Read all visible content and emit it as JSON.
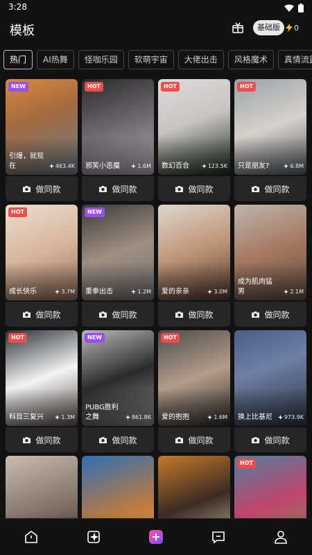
{
  "status": {
    "time": "3:28"
  },
  "header": {
    "title": "模板",
    "plan_label": "基础版",
    "credits": "0"
  },
  "tabs": [
    "热门",
    "AI热舞",
    "怪咖乐园",
    "软萌宇宙",
    "大佬出击",
    "风格魔术",
    "真情流露"
  ],
  "action_label": "做同款",
  "cards": [
    {
      "badge": "NEW",
      "title": "引爆，就现在",
      "uses": "463.4K",
      "bg": "linear-gradient(160deg,#d98a3d,#a56a3f 40%,#6d7c86)"
    },
    {
      "badge": "HOT",
      "title": "邪笑小恶魔",
      "uses": "1.6M",
      "bg": "linear-gradient(160deg,#2a2a2a,#6f6a70 50%,#b4aab7)"
    },
    {
      "badge": "HOT",
      "title": "数幻百合",
      "uses": "123.5K",
      "bg": "linear-gradient(160deg,#dcdcdc,#c8c4c2 45%,#1d2b1d)"
    },
    {
      "badge": "HOT",
      "title": "只是朋友?",
      "uses": "6.8M",
      "bg": "linear-gradient(160deg,#9aa3a9,#d7d1cc 50%,#545b62)"
    },
    {
      "badge": "HOT",
      "title": "成长快乐",
      "uses": "3.7M",
      "bg": "linear-gradient(160deg,#eadfd2,#d7b49a 50%,#8f6b58)"
    },
    {
      "badge": "NEW",
      "title": "重拳出击",
      "uses": "1.2M",
      "bg": "linear-gradient(160deg,#3c3c3c,#a08f82 50%,#6f6f6f)"
    },
    {
      "badge": "",
      "title": "爱的亲亲",
      "uses": "3.0M",
      "bg": "linear-gradient(160deg,#e0d7cf,#bd9376 50%,#513a30)"
    },
    {
      "badge": "",
      "title": "成为肌肉猛男",
      "uses": "2.1M",
      "bg": "linear-gradient(160deg,#bdb5ad,#a5775f 50%,#5d4c42)"
    },
    {
      "badge": "HOT",
      "title": "科目三复兴",
      "uses": "1.3M",
      "bg": "linear-gradient(160deg,#2d3136,#f4f4f4 50%,#5a524f)"
    },
    {
      "badge": "NEW",
      "title": "PUBG胜利之舞",
      "uses": "861.8K",
      "bg": "linear-gradient(160deg,#b9b9b9,#2b2b2b 50%,#8c8c8c)"
    },
    {
      "badge": "HOT",
      "title": "爱的抱抱",
      "uses": "1.6M",
      "bg": "linear-gradient(160deg,#4d4d4d,#b49c8a 50%,#2d2d2d)"
    },
    {
      "badge": "",
      "title": "换上比基尼",
      "uses": "973.9K",
      "bg": "linear-gradient(160deg,#4a5d8a,#6f7fa5 40%,#2a3443)"
    },
    {
      "badge": "",
      "title": "",
      "uses": "",
      "bg": "linear-gradient(160deg,#c9bdb3,#7d6c63 60%,#3c322e)"
    },
    {
      "badge": "",
      "title": "",
      "uses": "",
      "bg": "linear-gradient(160deg,#2f6fb5,#c07b3b 60%,#d9a36b)"
    },
    {
      "badge": "",
      "title": "",
      "uses": "",
      "bg": "linear-gradient(160deg,#c67a2b,#3b2b22 50%,#d0c4b3)"
    },
    {
      "badge": "HOT",
      "title": "",
      "uses": "",
      "bg": "linear-gradient(160deg,#4f7fa0,#c2456e 50%,#7e8f55)"
    }
  ],
  "nav": [
    "home-icon",
    "template-icon",
    "create-icon",
    "messages-icon",
    "profile-icon"
  ]
}
